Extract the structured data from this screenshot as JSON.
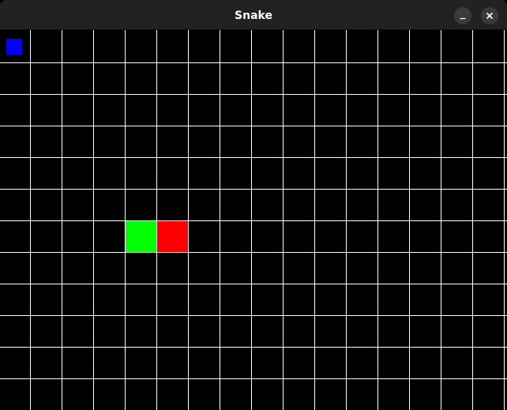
{
  "window": {
    "title": "Snake",
    "minimize_icon": "minimize-icon",
    "close_icon": "close-icon"
  },
  "game": {
    "grid": {
      "cols": 16,
      "rows": 12,
      "line_color": "#ffffff",
      "background": "#000000"
    },
    "food": {
      "col": 0,
      "row": 0,
      "color": "#0000ff"
    },
    "snake": [
      {
        "col": 4,
        "row": 6,
        "color": "#00ff00",
        "part": "body"
      },
      {
        "col": 5,
        "row": 6,
        "color": "#ff0000",
        "part": "head"
      }
    ]
  }
}
